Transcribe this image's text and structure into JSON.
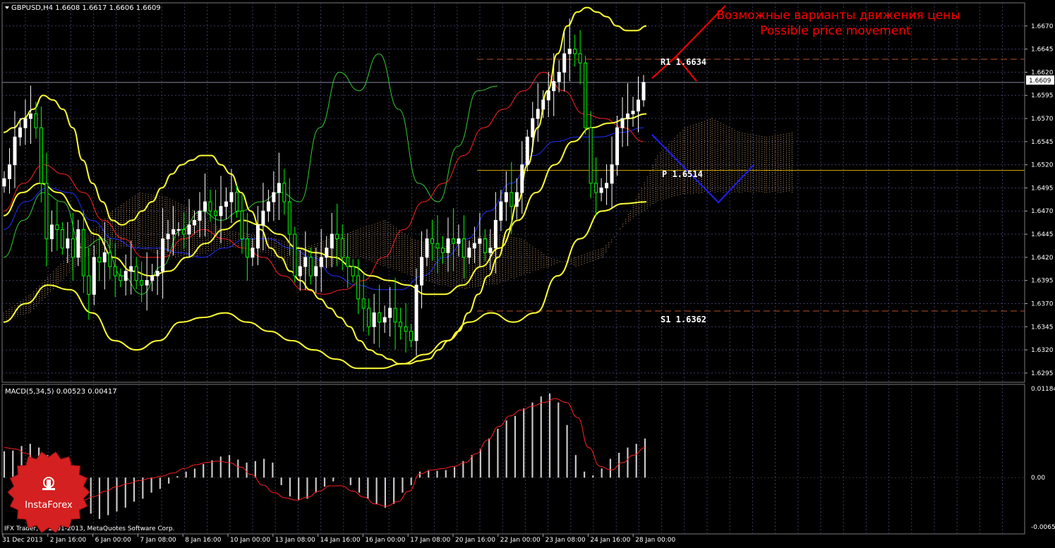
{
  "header": {
    "symbol_line": "GBPUSD,H4  1.6608 1.6617 1.6606 1.6609",
    "indicator_line": "MACD(5,34,5) 0.00523 0.00417"
  },
  "annotation": {
    "line_ru": "Возможные варианты движения цены",
    "line_en": "Possible price movement"
  },
  "levels": {
    "r1": {
      "label": "R1 1.6634",
      "value": 1.6634,
      "color": "#b5502a"
    },
    "p": {
      "label": "P 1.6514",
      "value": 1.6514,
      "color": "#c8a000"
    },
    "s1": {
      "label": "S1 1.6362",
      "value": 1.6362,
      "color": "#b5502a"
    }
  },
  "current_price": "1.6609",
  "footer": {
    "copyright": "IFX Trader, © 2001-2013, MetaQuotes Software Corp."
  },
  "logo": {
    "text": "InstaForex"
  },
  "colors": {
    "background": "#000000",
    "grid": "#3c3c64",
    "bull_candle": "#ffffff",
    "bear_candle": "#00ff00",
    "bollinger": "#ffff33",
    "tenkan": "#ff2020",
    "kijun": "#2030ff",
    "chikou": "#33cc33",
    "cloud": "#d2a070",
    "macd_hist": "#c8c8c8",
    "macd_signal": "#ff2020",
    "scenario_up": "#ff0000",
    "scenario_down": "#2020ff",
    "annotation": "#ff0000",
    "logo": "#d42020"
  },
  "chart_data": [
    {
      "type": "candlestick",
      "title": "GBPUSD,H4",
      "ylim": [
        1.6285,
        1.6695
      ],
      "y_ticks": [
        "1.6670",
        "1.6645",
        "1.6620",
        "1.6595",
        "1.6570",
        "1.6545",
        "1.6520",
        "1.6495",
        "1.6470",
        "1.6445",
        "1.6420",
        "1.6395",
        "1.6370",
        "1.6345",
        "1.6320",
        "1.6295"
      ],
      "x_ticks": [
        "31 Dec 2013",
        "2 Jan 16:00",
        "6 Jan 00:00",
        "7 Jan 08:00",
        "8 Jan 16:00",
        "10 Jan 00:00",
        "13 Jan 08:00",
        "14 Jan 16:00",
        "16 Jan 00:00",
        "17 Jan 08:00",
        "20 Jan 16:00",
        "22 Jan 00:00",
        "23 Jan 08:00",
        "24 Jan 16:00",
        "28 Jan 00:00"
      ],
      "close_series": [
        1.6505,
        1.652,
        1.655,
        1.656,
        1.657,
        1.6575,
        1.656,
        1.65,
        1.644,
        1.6455,
        1.645,
        1.643,
        1.644,
        1.642,
        1.645,
        1.64,
        1.638,
        1.642,
        1.6415,
        1.6425,
        1.641,
        1.64,
        1.6395,
        1.6405,
        1.641,
        1.6395,
        1.639,
        1.6395,
        1.64,
        1.6405,
        1.644,
        1.6445,
        1.645,
        1.645,
        1.6445,
        1.6455,
        1.646,
        1.647,
        1.648,
        1.647,
        1.6465,
        1.6475,
        1.648,
        1.649,
        1.647,
        1.644,
        1.642,
        1.643,
        1.6455,
        1.647,
        1.648,
        1.649,
        1.65,
        1.648,
        1.6445,
        1.64,
        1.641,
        1.642,
        1.64,
        1.641,
        1.642,
        1.643,
        1.6445,
        1.644,
        1.642,
        1.641,
        1.64,
        1.6375,
        1.6365,
        1.6345,
        1.636,
        1.635,
        1.6355,
        1.6365,
        1.635,
        1.6345,
        1.634,
        1.633,
        1.639,
        1.642,
        1.644,
        1.6435,
        1.643,
        1.6425,
        1.644,
        1.6435,
        1.644,
        1.642,
        1.643,
        1.6435,
        1.644,
        1.6425,
        1.643,
        1.646,
        1.648,
        1.649,
        1.6475,
        1.649,
        1.652,
        1.655,
        1.657,
        1.658,
        1.659,
        1.66,
        1.661,
        1.662,
        1.664,
        1.6645,
        1.664,
        1.663,
        1.656,
        1.65,
        1.649,
        1.6495,
        1.65,
        1.652,
        1.656,
        1.657,
        1.6575,
        1.6578,
        1.659,
        1.6609
      ],
      "bollinger_upper": [
        1.6555,
        1.656,
        1.657,
        1.658,
        1.6595,
        1.659,
        1.658,
        1.656,
        1.6525,
        1.65,
        1.648,
        1.646,
        1.6455,
        1.646,
        1.647,
        1.648,
        1.6495,
        1.651,
        1.652,
        1.6525,
        1.653,
        1.653,
        1.652,
        1.651,
        1.649,
        1.647,
        1.645,
        1.643,
        1.642,
        1.6405,
        1.6395,
        1.6385,
        1.6375,
        1.6365,
        1.6355,
        1.6345,
        1.633,
        1.632,
        1.6315,
        1.631,
        1.6305,
        1.6305,
        1.6308,
        1.631,
        1.632,
        1.633,
        1.634,
        1.636,
        1.638,
        1.64,
        1.642,
        1.645,
        1.648,
        1.652,
        1.656,
        1.66,
        1.664,
        1.667,
        1.6685,
        1.669,
        1.6685,
        1.668,
        1.667,
        1.6665,
        1.6665,
        1.667
      ],
      "bollinger_middle": [
        1.6465,
        1.649,
        1.65,
        1.649,
        1.647,
        1.6445,
        1.642,
        1.6405,
        1.64,
        1.6405,
        1.642,
        1.6435,
        1.645,
        1.646,
        1.6455,
        1.6445,
        1.643,
        1.6425,
        1.642,
        1.641,
        1.64,
        1.6395,
        1.639,
        1.638,
        1.638,
        1.639,
        1.641,
        1.643,
        1.646,
        1.649,
        1.652,
        1.6545,
        1.656,
        1.6565,
        1.657,
        1.6575
      ],
      "bollinger_lower": [
        1.635,
        1.637,
        1.639,
        1.6385,
        1.636,
        1.633,
        1.632,
        1.633,
        1.635,
        1.6355,
        1.636,
        1.635,
        1.634,
        1.633,
        1.632,
        1.631,
        1.63,
        1.63,
        1.6305,
        1.6315,
        1.633,
        1.635,
        1.636,
        1.635,
        1.636,
        1.64,
        1.644,
        1.647,
        1.6478,
        1.648
      ],
      "tenkan": [
        1.647,
        1.65,
        1.652,
        1.651,
        1.649,
        1.646,
        1.644,
        1.642,
        1.642,
        1.644,
        1.645,
        1.644,
        1.643,
        1.642,
        1.64,
        1.6385,
        1.638,
        1.6385,
        1.6395,
        1.642,
        1.645,
        1.648,
        1.65,
        1.653,
        1.656,
        1.658,
        1.66,
        1.662,
        1.66,
        1.6575,
        1.657,
        1.656,
        1.6545
      ],
      "kijun": [
        1.645,
        1.648,
        1.6495,
        1.649,
        1.646,
        1.644,
        1.643,
        1.643,
        1.6425,
        1.642,
        1.643,
        1.644,
        1.644,
        1.643,
        1.642,
        1.64,
        1.639,
        1.6385,
        1.6385,
        1.64,
        1.642,
        1.644,
        1.647,
        1.65,
        1.653,
        1.6545,
        1.655,
        1.655,
        1.6555,
        1.656
      ],
      "chikou": [
        1.642,
        1.646,
        1.649,
        1.648,
        1.643,
        1.644,
        1.64,
        1.638,
        1.641,
        1.645,
        1.647,
        1.646,
        1.647,
        1.648,
        1.649,
        1.648,
        1.656,
        1.662,
        1.66,
        1.664,
        1.658,
        1.65,
        1.648,
        1.654,
        1.66,
        1.6605
      ],
      "cloud_upper": [
        1.636,
        1.638,
        1.641,
        1.644,
        1.647,
        1.649,
        1.6485,
        1.647,
        1.645,
        1.6445,
        1.644,
        1.643,
        1.644,
        1.645,
        1.646,
        1.644,
        1.643,
        1.644,
        1.6445,
        1.644,
        1.642,
        1.641,
        1.642,
        1.647,
        1.653,
        1.656,
        1.657,
        1.6555,
        1.655,
        1.6555
      ],
      "cloud_lower": [
        1.635,
        1.636,
        1.639,
        1.642,
        1.643,
        1.643,
        1.642,
        1.642,
        1.643,
        1.643,
        1.642,
        1.64,
        1.641,
        1.642,
        1.641,
        1.64,
        1.639,
        1.6385,
        1.639,
        1.64,
        1.641,
        1.642,
        1.643,
        1.646,
        1.648,
        1.6488,
        1.649,
        1.649,
        1.649,
        1.649
      ]
    },
    {
      "type": "bar",
      "title": "MACD(5,34,5)",
      "ylim": [
        -0.00655,
        0.01184
      ],
      "y_ticks": [
        "0.01184",
        "0.00",
        "-0.00655"
      ],
      "values": [
        0.0035,
        0.0036,
        0.0042,
        0.0045,
        0.004,
        0.003,
        0.0005,
        -0.0005,
        -0.0025,
        -0.004,
        -0.0048,
        -0.0055,
        -0.005,
        -0.0045,
        -0.004,
        -0.0032,
        -0.0028,
        -0.002,
        -0.0015,
        -0.0008,
        0.0002,
        0.0008,
        0.0012,
        0.0018,
        0.0023,
        0.0028,
        0.003,
        0.0024,
        0.002,
        0.0022,
        0.0025,
        0.002,
        -0.001,
        -0.0025,
        -0.003,
        -0.0028,
        -0.002,
        -0.0012,
        -0.0005,
        0.0,
        -0.001,
        -0.002,
        -0.0028,
        -0.0035,
        -0.004,
        -0.0035,
        -0.002,
        -0.001,
        0.0008,
        0.001,
        0.0009,
        0.001,
        0.0014,
        0.0022,
        0.003,
        0.0038,
        0.0052,
        0.0065,
        0.0076,
        0.0082,
        0.0092,
        0.01,
        0.0108,
        0.0112,
        0.01,
        0.007,
        0.003,
        0.0008,
        0.0003,
        0.0012,
        0.0025,
        0.0033,
        0.004,
        0.0045,
        0.0052
      ],
      "signal": [
        0.004,
        0.0038,
        0.0032,
        0.0018,
        0.0,
        -0.0018,
        -0.0028,
        -0.003,
        -0.0025,
        -0.0018,
        -0.0012,
        -0.0008,
        -0.0004,
        -0.0001,
        0.0002,
        0.0006,
        0.0012,
        0.0017,
        0.002,
        0.0022,
        0.002,
        0.0014,
        0.0004,
        -0.001,
        -0.002,
        -0.0027,
        -0.003,
        -0.0026,
        -0.0018,
        -0.0011,
        -0.0011,
        -0.0018,
        -0.0026,
        -0.0035,
        -0.0038,
        -0.0032,
        -0.0018,
        0.0005,
        0.001,
        0.0012,
        0.0015,
        0.002,
        0.0032,
        0.005,
        0.0068,
        0.0082,
        0.009,
        0.0095,
        0.01,
        0.0105,
        0.01,
        0.008,
        0.004,
        0.0015,
        0.001,
        0.002,
        0.003,
        0.004
      ]
    }
  ]
}
